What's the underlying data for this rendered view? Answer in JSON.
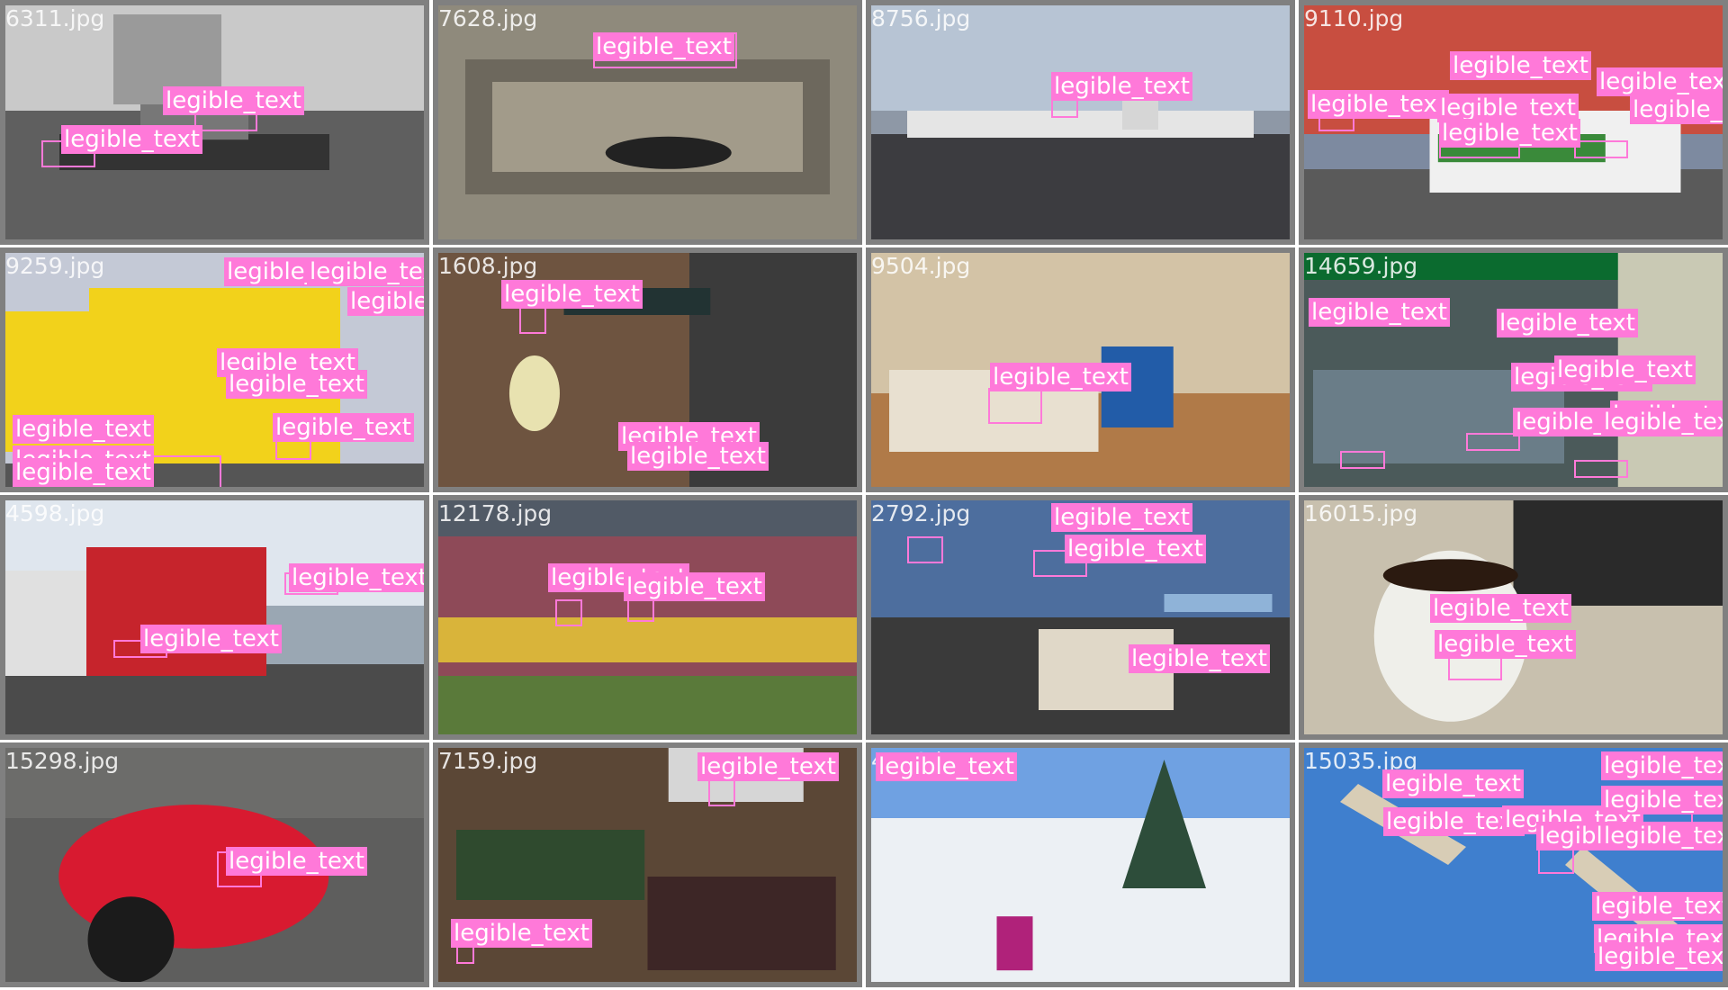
{
  "palette": {
    "label_bg": "#ff79d9",
    "label_text": "#ffffff",
    "tile_border": "#808080"
  },
  "tiles": [
    {
      "filename": "6311.jpg",
      "scene": "tugboat",
      "bg": "#8c8c8c",
      "labels": [
        "legible_text",
        "legible_text"
      ]
    },
    {
      "filename": "7628.jpg",
      "scene": "drawer",
      "bg": "#8f8a7c",
      "labels": [
        "legible_text"
      ]
    },
    {
      "filename": "8756.jpg",
      "scene": "airport",
      "bg": "#8e98a6",
      "labels": [
        "legible_text"
      ]
    },
    {
      "filename": "9110.jpg",
      "scene": "street-truck",
      "bg": "#7d8aa0",
      "labels": [
        "legible_text",
        "legible_text",
        "legible_text",
        "legible_text",
        "legible_text",
        "legible_text"
      ]
    },
    {
      "filename": "9259.jpg",
      "scene": "yellow-bus",
      "bg": "#b8a24a",
      "labels": [
        "legible_text",
        "legible_text",
        "legible_text",
        "legible_text",
        "legible_text",
        "legible_text",
        "legible_text",
        "legible_text",
        "legible_text"
      ]
    },
    {
      "filename": "1608.jpg",
      "scene": "wine",
      "bg": "#6e5440",
      "labels": [
        "legible_text",
        "legible_text",
        "legible_text"
      ]
    },
    {
      "filename": "9504.jpg",
      "scene": "living-room",
      "bg": "#c6b59b",
      "labels": [
        "legible_text"
      ]
    },
    {
      "filename": "14659.jpg",
      "scene": "store",
      "bg": "#5d6b6b",
      "labels": [
        "legible_text",
        "legible_text",
        "legible_text",
        "legible_text",
        "legible_text",
        "legible_text",
        "legible_text"
      ]
    },
    {
      "filename": "4598.jpg",
      "scene": "buses",
      "bg": "#9aa7b3",
      "labels": [
        "legible_text",
        "legible_text"
      ]
    },
    {
      "filename": "12178.jpg",
      "scene": "train",
      "bg": "#8b6b6e",
      "labels": [
        "legible_text",
        "legible_text"
      ]
    },
    {
      "filename": "2792.jpg",
      "scene": "cafe",
      "bg": "#6f8fb8",
      "labels": [
        "legible_text",
        "legible_text",
        "legible_text"
      ]
    },
    {
      "filename": "16015.jpg",
      "scene": "coffee",
      "bg": "#b3aa95",
      "labels": [
        "legible_text",
        "legible_text"
      ]
    },
    {
      "filename": "15298.jpg",
      "scene": "motorbike",
      "bg": "#7a7a78",
      "labels": [
        "legible_text"
      ]
    },
    {
      "filename": "7159.jpg",
      "scene": "books",
      "bg": "#6e5a48",
      "labels": [
        "legible_text",
        "legible_text"
      ]
    },
    {
      "filename": "4479.jpg",
      "scene": "ski",
      "bg": "#9fb7d6",
      "labels": [
        "legible_text"
      ]
    },
    {
      "filename": "15035.jpg",
      "scene": "planes",
      "bg": "#3f7fce",
      "labels": [
        "legible_text",
        "legible_text",
        "legible_text",
        "legible_text",
        "legible_text",
        "legible_text",
        "legible_text",
        "legible_text",
        "legible_text",
        "legible_text"
      ]
    }
  ]
}
